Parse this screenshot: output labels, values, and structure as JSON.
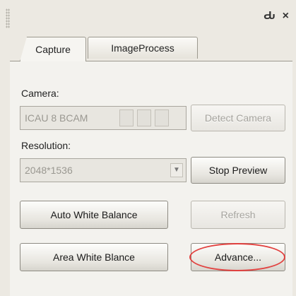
{
  "topbar": {
    "pin_icon": "pin-icon",
    "close_icon": "close-icon",
    "pin_glyph": "Ԃ",
    "close_glyph": "×"
  },
  "tabs": [
    {
      "label": "Capture",
      "active": true
    },
    {
      "label": "ImageProcess",
      "active": false
    }
  ],
  "camera": {
    "label": "Camera:",
    "value": "ICAU 8 BCAM",
    "detect_button": "Detect Camera"
  },
  "resolution": {
    "label": "Resolution:",
    "value": "2048*1536",
    "stop_preview_button": "Stop Preview"
  },
  "buttons": {
    "auto_white_balance": "Auto White Balance",
    "refresh": "Refresh",
    "area_white_balance": "Area White Blance",
    "advance": "Advance..."
  },
  "colors": {
    "panel_bg": "#ece9e2",
    "highlight": "#e2413f"
  }
}
